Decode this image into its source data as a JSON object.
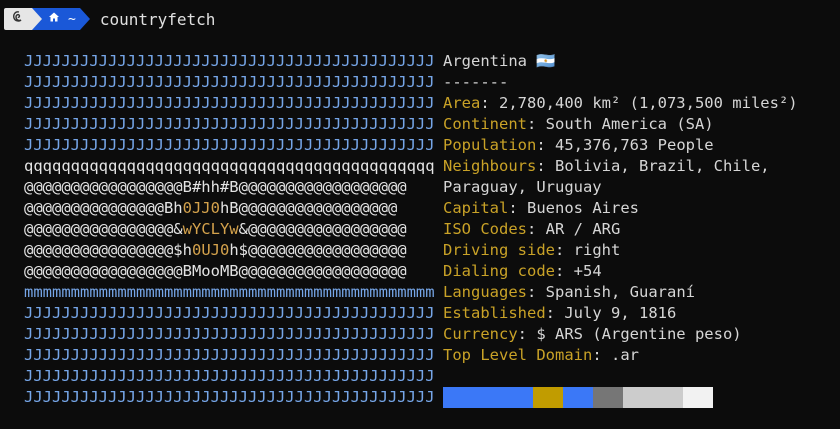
{
  "prompt": {
    "os_icon": "debian-icon",
    "home_icon": "home-icon",
    "dir": "~",
    "command": "countryfetch"
  },
  "flag_rows": [
    {
      "parts": [
        {
          "t": "JJJJJJJJJJJJJJJJJJJJJJJJJJJJJJJJJJJJJJJJJJJJ",
          "c": "blue"
        }
      ]
    },
    {
      "parts": [
        {
          "t": "JJJJJJJJJJJJJJJJJJJJJJJJJJJJJJJJJJJJJJJJJJJJ",
          "c": "blue"
        }
      ]
    },
    {
      "parts": [
        {
          "t": "JJJJJJJJJJJJJJJJJJJJJJJJJJJJJJJJJJJJJJJJJJJJ",
          "c": "blue"
        }
      ]
    },
    {
      "parts": [
        {
          "t": "JJJJJJJJJJJJJJJJJJJJJJJJJJJJJJJJJJJJJJJJJJJJ",
          "c": "blue"
        }
      ]
    },
    {
      "parts": [
        {
          "t": "JJJJJJJJJJJJJJJJJJJJJJJJJJJJJJJJJJJJJJJJJJJJ",
          "c": "blue"
        }
      ]
    },
    {
      "parts": [
        {
          "t": "qqqqqqqqqqqqqqqqqqqqqqqqqqqqqqqqqqqqqqqqqqqq",
          "c": "white"
        }
      ]
    },
    {
      "parts": [
        {
          "t": "@@@@@@@@@@@@@@@@@B#hh#B@@@@@@@@@@@@@@@@@@",
          "c": "white"
        }
      ]
    },
    {
      "parts": [
        {
          "t": "@@@@@@@@@@@@@@@Bh",
          "c": "white"
        },
        {
          "t": "0JJ0",
          "c": "gold"
        },
        {
          "t": "hB@@@@@@@@@@@@@@@@@",
          "c": "white"
        }
      ]
    },
    {
      "parts": [
        {
          "t": "@@@@@@@@@@@@@@@@&",
          "c": "white"
        },
        {
          "t": "wYCLYw",
          "c": "gold"
        },
        {
          "t": "&@@@@@@@@@@@@@@@@@",
          "c": "white"
        }
      ]
    },
    {
      "parts": [
        {
          "t": "@@@@@@@@@@@@@@@@$h",
          "c": "white"
        },
        {
          "t": "0UJ0",
          "c": "gold"
        },
        {
          "t": "h$@@@@@@@@@@@@@@@@@",
          "c": "white"
        }
      ]
    },
    {
      "parts": [
        {
          "t": "@@@@@@@@@@@@@@@@@BMooMB@@@@@@@@@@@@@@@@@@",
          "c": "white"
        }
      ]
    },
    {
      "parts": [
        {
          "t": "mmmmmmmmmmmmmmmmmmmmmmmmmmmmmmmmmmmmmmmmmmmm",
          "c": "blue"
        }
      ]
    },
    {
      "parts": [
        {
          "t": "JJJJJJJJJJJJJJJJJJJJJJJJJJJJJJJJJJJJJJJJJJJJ",
          "c": "blue"
        }
      ]
    },
    {
      "parts": [
        {
          "t": "JJJJJJJJJJJJJJJJJJJJJJJJJJJJJJJJJJJJJJJJJJJJ",
          "c": "blue"
        }
      ]
    },
    {
      "parts": [
        {
          "t": "JJJJJJJJJJJJJJJJJJJJJJJJJJJJJJJJJJJJJJJJJJJJ",
          "c": "blue"
        }
      ]
    },
    {
      "parts": [
        {
          "t": "JJJJJJJJJJJJJJJJJJJJJJJJJJJJJJJJJJJJJJJJJJJJ",
          "c": "blue"
        }
      ]
    },
    {
      "parts": [
        {
          "t": "JJJJJJJJJJJJJJJJJJJJJJJJJJJJJJJJJJJJJJJJJJJJ",
          "c": "blue"
        }
      ]
    }
  ],
  "info": {
    "title": "Argentina 🇦🇷",
    "divider": "-------",
    "fields": [
      {
        "label": "Area",
        "value": "2,780,400 km² (1,073,500 miles²)"
      },
      {
        "label": "Continent",
        "value": "South America (SA)"
      },
      {
        "label": "Population",
        "value": "45,376,763 People"
      },
      {
        "label": "Neighbours",
        "value": "Bolivia, Brazil, Chile,"
      },
      {
        "label": "",
        "value": "Paraguay, Uruguay"
      },
      {
        "label": "Capital",
        "value": "Buenos Aires"
      },
      {
        "label": "ISO Codes",
        "value": "AR / ARG"
      },
      {
        "label": "Driving side",
        "value": "right"
      },
      {
        "label": "Dialing code",
        "value": "+54"
      },
      {
        "label": "Languages",
        "value": "Spanish, Guaraní"
      },
      {
        "label": "Established",
        "value": "July 9, 1816"
      },
      {
        "label": "Currency",
        "value": "$ ARS (Argentine peso)"
      },
      {
        "label": "Top Level Domain",
        "value": ".ar"
      }
    ]
  },
  "palette": [
    {
      "color": "#3b78f7",
      "units": 3
    },
    {
      "color": "#c19c00",
      "units": 1
    },
    {
      "color": "#3b78f7",
      "units": 1
    },
    {
      "color": "#767676",
      "units": 1
    },
    {
      "color": "#cccccc",
      "units": 2
    },
    {
      "color": "#f2f2f2",
      "units": 1
    }
  ],
  "colors": {
    "blue": "#76a6e8",
    "white": "#e4e4e4",
    "gold": "#d4a24c",
    "label": "#c9a227"
  }
}
